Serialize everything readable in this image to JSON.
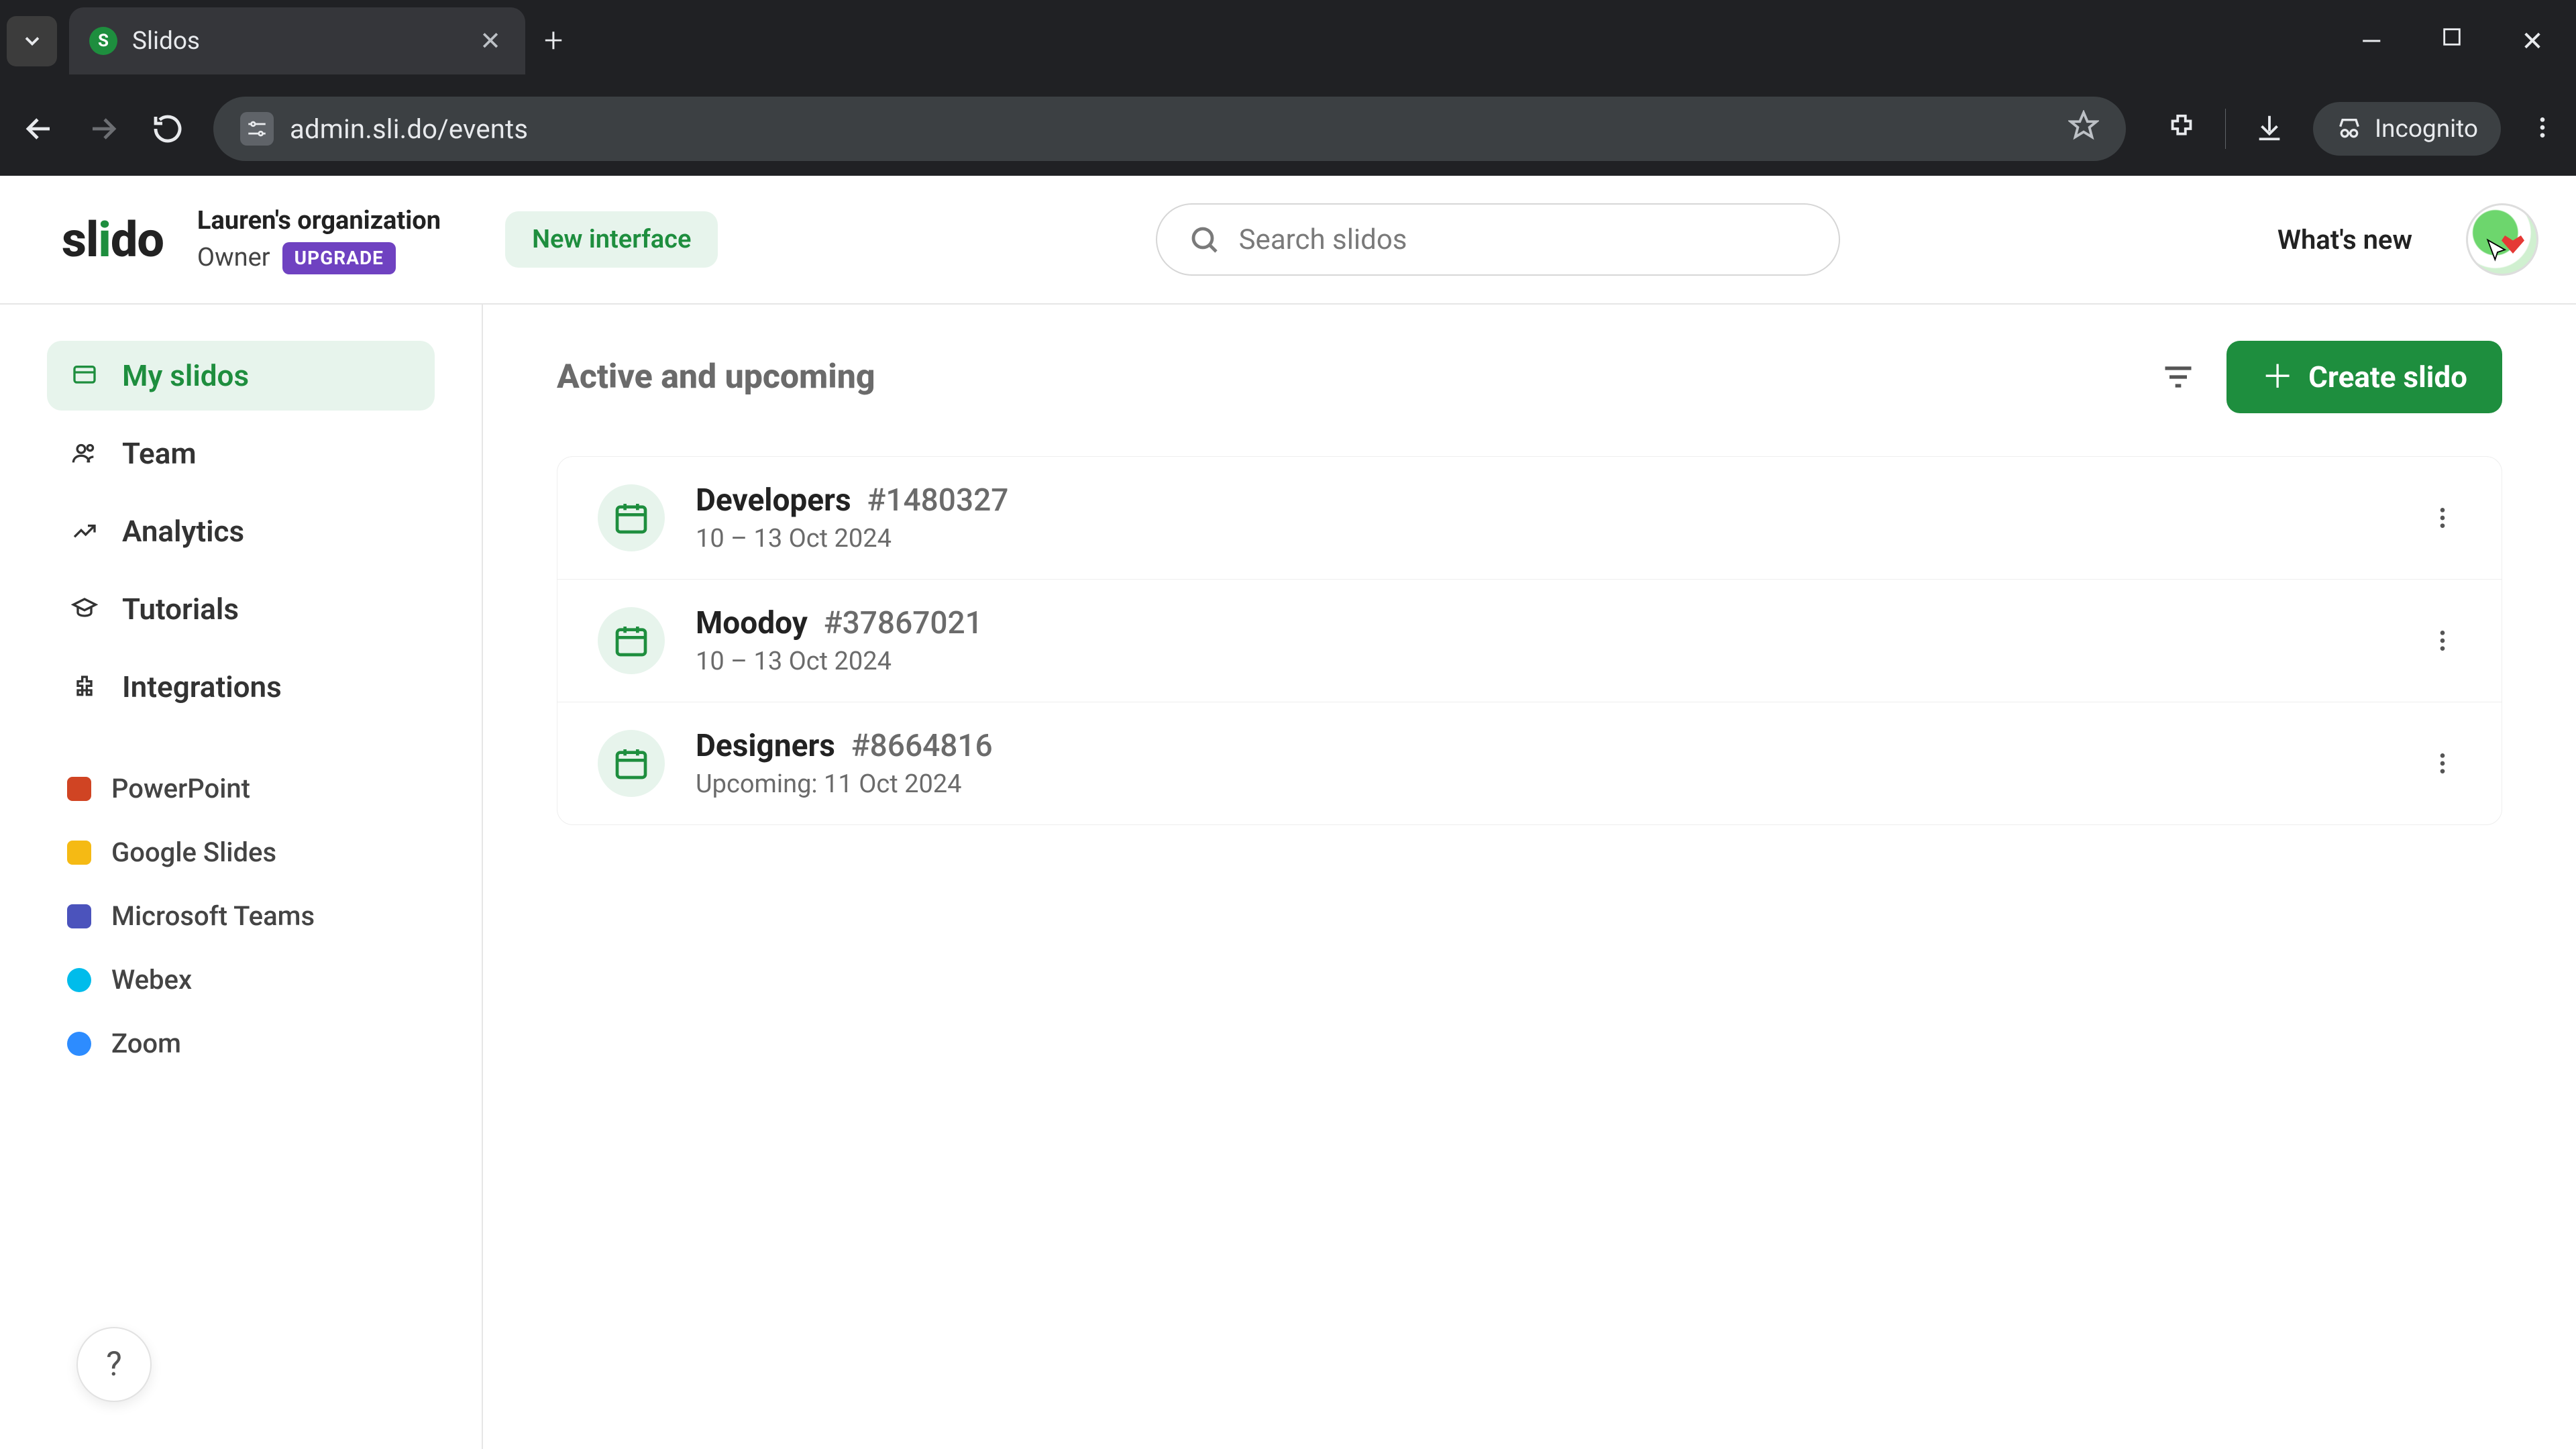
{
  "browser": {
    "tab_title": "Slidos",
    "url": "admin.sli.do/events",
    "incognito_label": "Incognito"
  },
  "header": {
    "logo_text": "slido",
    "org_name": "Lauren's organization",
    "role": "Owner",
    "upgrade_badge": "UPGRADE",
    "new_interface": "New interface",
    "search_placeholder": "Search slidos",
    "whats_new": "What's new"
  },
  "sidebar": {
    "items": [
      {
        "label": "My slidos",
        "active": true
      },
      {
        "label": "Team"
      },
      {
        "label": "Analytics"
      },
      {
        "label": "Tutorials"
      },
      {
        "label": "Integrations"
      }
    ],
    "integrations": [
      {
        "label": "PowerPoint",
        "swatch": "pp"
      },
      {
        "label": "Google Slides",
        "swatch": "gs"
      },
      {
        "label": "Microsoft Teams",
        "swatch": "mt"
      },
      {
        "label": "Webex",
        "swatch": "wx"
      },
      {
        "label": "Zoom",
        "swatch": "zm"
      }
    ]
  },
  "main": {
    "section_title": "Active and upcoming",
    "create_label": "Create slido",
    "events": [
      {
        "name": "Developers",
        "code": "#1480327",
        "date": "10 – 13 Oct 2024"
      },
      {
        "name": "Moodoy",
        "code": "#37867021",
        "date": "10 – 13 Oct 2024"
      },
      {
        "name": "Designers",
        "code": "#8664816",
        "date": "Upcoming: 11 Oct 2024"
      }
    ]
  },
  "help_fab": "?",
  "colors": {
    "brand_green": "#1e8e3e",
    "badge_purple": "#6f42c1"
  }
}
